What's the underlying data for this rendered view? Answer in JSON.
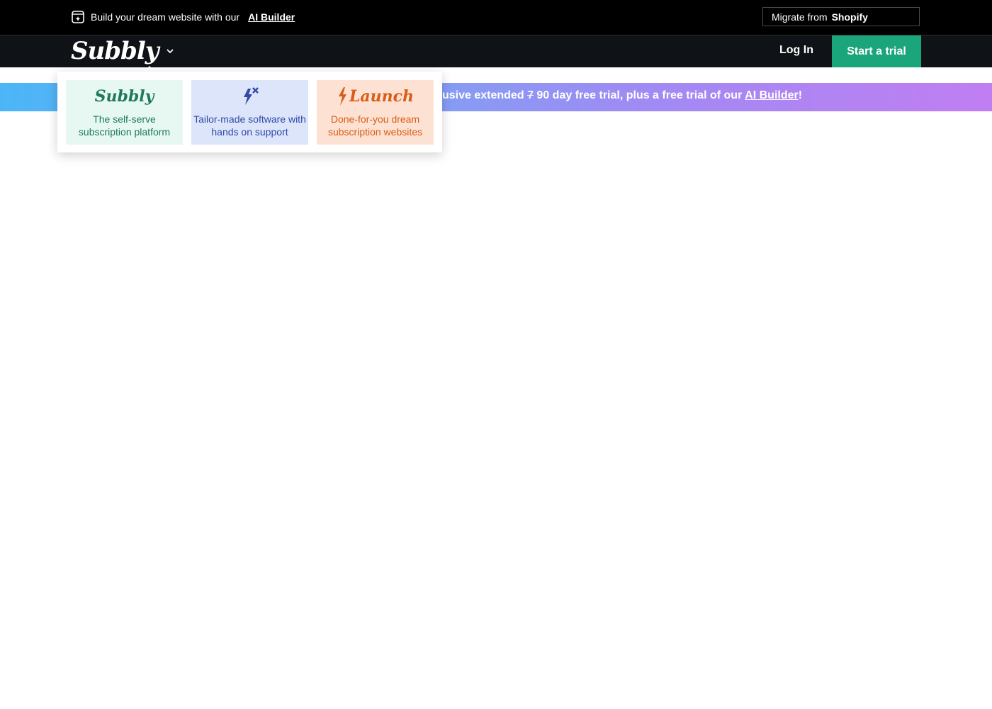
{
  "topbar": {
    "message": "Build your dream website with our",
    "link": "AI Builder",
    "migrate_prefix": "Migrate from",
    "migrate_brand": "Shopify"
  },
  "nav": {
    "logo": "Subbly",
    "login": "Log In",
    "trial": "Start a trial"
  },
  "promo": {
    "text_before": "usive extended",
    "struck": "7",
    "bold_number": "90",
    "text_after": "day free trial, plus a free trial of our",
    "link": "AI Builder",
    "end": "!"
  },
  "dropdown": {
    "cards": [
      {
        "brand": "Subbly",
        "desc": "The self-serve subscription platform"
      },
      {
        "brand": "",
        "desc": "Tailor-made software with hands on support"
      },
      {
        "brand": "Launch",
        "desc": "Done-for-you dream subscription websites"
      }
    ]
  },
  "colors": {
    "topbar_bg": "#000000",
    "nav_bg": "#0f1216",
    "trial_green": "#1aa57a",
    "card1": "#e7f8f3",
    "card2": "#dde5fb",
    "card3": "#fde2d3"
  }
}
